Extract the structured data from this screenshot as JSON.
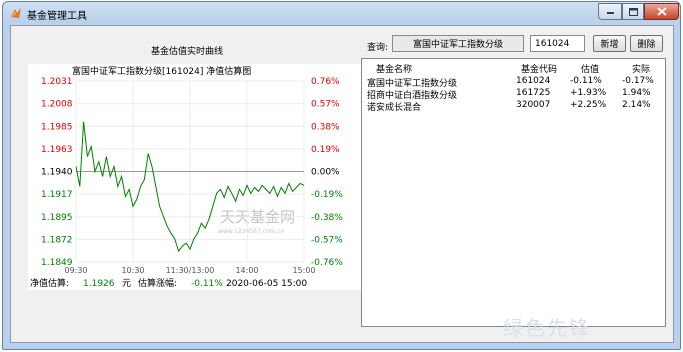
{
  "window": {
    "title": "基金管理工具"
  },
  "left_panel": {
    "heading": "基金估值实时曲线"
  },
  "chart_data": {
    "type": "line",
    "title": "富国中证军工指数分级[161024]  净值估算图",
    "y_ticks_left": [
      "1.2031",
      "1.2008",
      "1.1985",
      "1.1963",
      "1.1940",
      "1.1917",
      "1.1895",
      "1.1872",
      "1.1849"
    ],
    "y_ticks_right": [
      "0.76%",
      "0.57%",
      "0.38%",
      "0.19%",
      "0.00%",
      "-0.19%",
      "-0.38%",
      "-0.57%",
      "-0.76%"
    ],
    "x_ticks": [
      "09:30",
      "10:30",
      "11:30/13:00",
      "14:00",
      "15:00"
    ],
    "ylim": [
      1.1849,
      1.2031
    ],
    "baseline": 1.194,
    "series": [
      {
        "x": [
          0,
          4,
          8,
          12,
          16,
          20,
          24,
          28,
          32,
          36,
          40,
          44,
          48,
          52,
          56,
          60,
          64,
          68,
          72,
          76,
          80,
          84,
          88,
          92,
          96,
          100,
          104,
          108,
          112,
          116,
          120,
          124,
          128,
          132,
          136,
          140,
          144,
          148,
          152,
          156,
          160,
          164,
          168,
          172,
          176,
          180,
          184,
          188,
          192,
          196,
          200,
          204,
          208,
          212,
          216,
          220,
          224,
          228,
          232,
          236,
          240
        ],
        "values": [
          1.1945,
          1.1925,
          1.199,
          1.1955,
          1.1965,
          1.194,
          1.195,
          1.1935,
          1.1955,
          1.1935,
          1.1945,
          1.1925,
          1.1935,
          1.1915,
          1.1922,
          1.1905,
          1.1912,
          1.1925,
          1.1932,
          1.1958,
          1.1945,
          1.1925,
          1.1905,
          1.1895,
          1.1885,
          1.1878,
          1.1872,
          1.186,
          1.1865,
          1.1868,
          1.1862,
          1.1872,
          1.1878,
          1.1888,
          1.1883,
          1.1892,
          1.1905,
          1.1918,
          1.1922,
          1.1914,
          1.1925,
          1.1918,
          1.191,
          1.1922,
          1.1916,
          1.1926,
          1.1918,
          1.1924,
          1.192,
          1.1926,
          1.1922,
          1.1918,
          1.1925,
          1.1915,
          1.1924,
          1.1918,
          1.1928,
          1.192,
          1.1924,
          1.1928,
          1.1926
        ]
      }
    ],
    "colors": {
      "up": "#e60000",
      "down": "#008000",
      "line": "#008000",
      "baseline": "#999999"
    },
    "watermark": "天天基金网",
    "watermark_url": "www.1234567.com.cn",
    "footer": {
      "nav_label": "净值估算:",
      "nav_value": "1.1926",
      "unit": "元",
      "change_label": "估算涨幅:",
      "change_value": "-0.11%",
      "timestamp": "2020-06-05 15:00"
    }
  },
  "query": {
    "label": "查询:",
    "fund_name": "富国中证军工指数分级",
    "code_value": "161024",
    "add_button": "新增",
    "delete_button": "删除"
  },
  "fund_list": {
    "columns": [
      "基金名称",
      "基金代码",
      "估值",
      "实际"
    ],
    "rows": [
      [
        "富国中证军工指数分级",
        "161024",
        "-0.11%",
        "-0.17%"
      ],
      [
        "招商中证白酒指数分级",
        "161725",
        "+1.93%",
        "1.94%"
      ],
      [
        "诺安成长混合",
        "320007",
        "+2.25%",
        "2.14%"
      ]
    ]
  },
  "site_watermark": "绿色先锋"
}
